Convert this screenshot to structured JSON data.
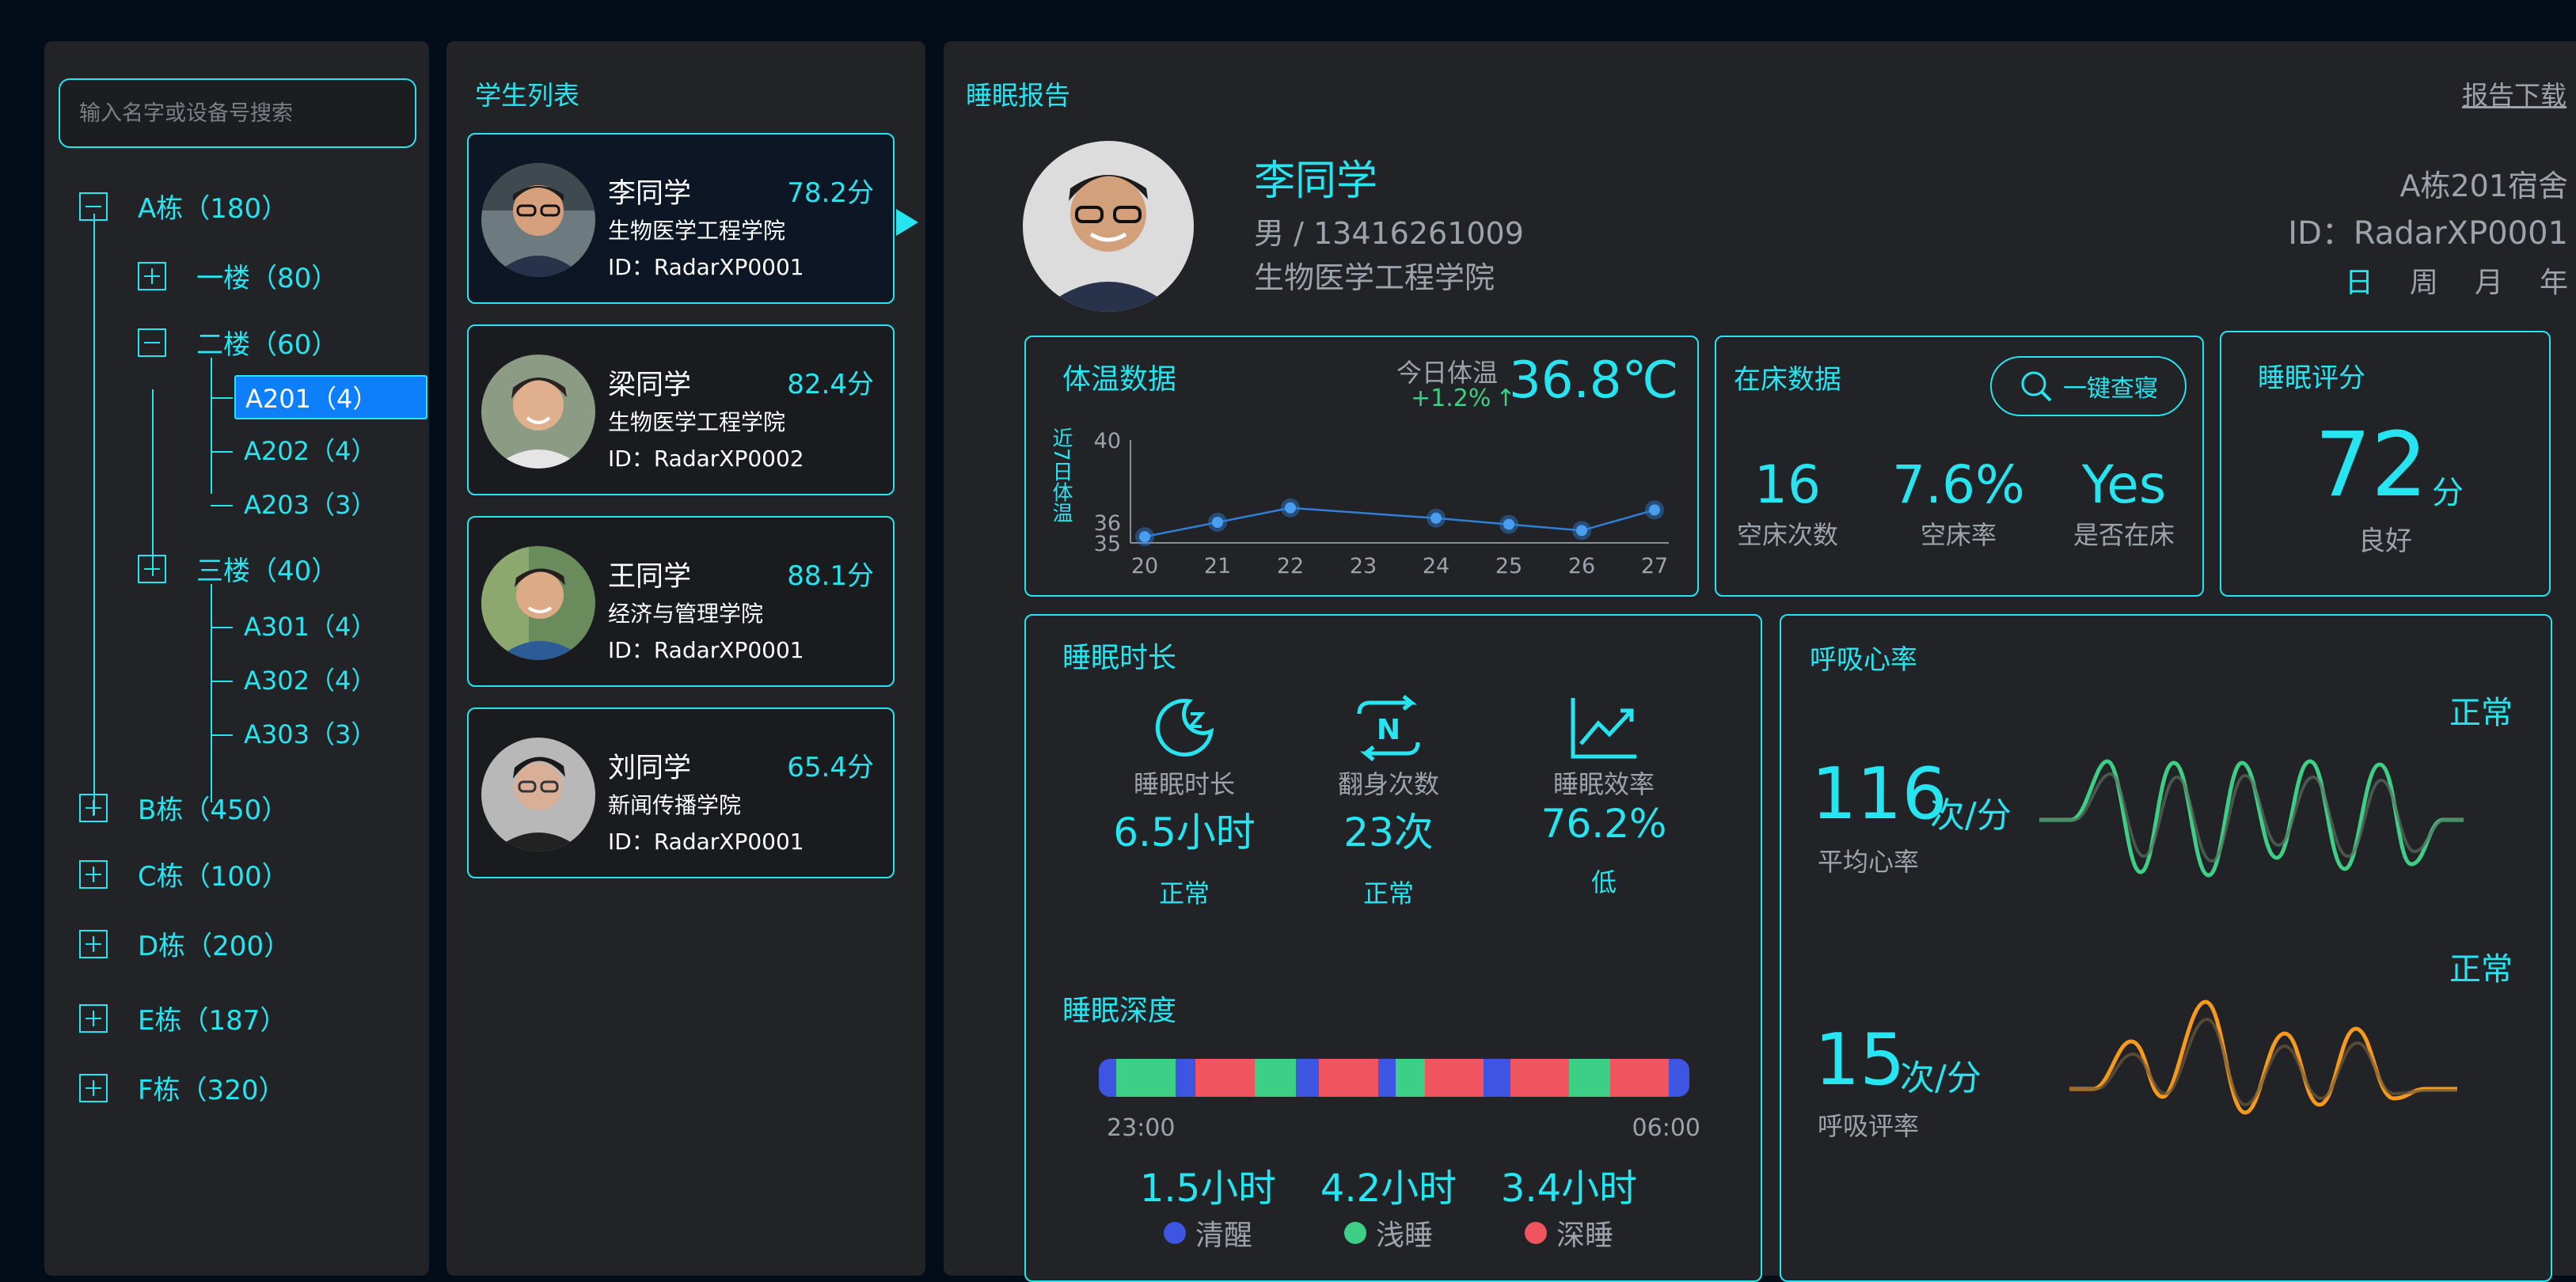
{
  "sidebar": {
    "search_placeholder": "输入名字或设备号搜索",
    "buildings": [
      {
        "label": "A栋（180）",
        "expanded": true
      },
      {
        "label": "B栋（450）",
        "expanded": false
      },
      {
        "label": "C栋（100）",
        "expanded": false
      },
      {
        "label": "D栋（200）",
        "expanded": false
      },
      {
        "label": "E栋（187）",
        "expanded": false
      },
      {
        "label": "F栋（320）",
        "expanded": false
      }
    ],
    "floors": [
      {
        "label": "一楼（80）",
        "expanded": false
      },
      {
        "label": "二楼（60）",
        "expanded": true
      },
      {
        "label": "三楼（40）",
        "expanded": true
      }
    ],
    "rooms_floor2": [
      "A201（4）",
      "A202（4）",
      "A203（3）"
    ],
    "rooms_floor3": [
      "A301（4）",
      "A302（4）",
      "A303（3）"
    ],
    "selected_room": "A201（4）"
  },
  "student_list": {
    "title": "学生列表",
    "students": [
      {
        "name": "李同学",
        "score": "78.2分",
        "college": "生物医学工程学院",
        "id": "ID：RadarXP0001"
      },
      {
        "name": "梁同学",
        "score": "82.4分",
        "college": "生物医学工程学院",
        "id": "ID：RadarXP0002"
      },
      {
        "name": "王同学",
        "score": "88.1分",
        "college": "经济与管理学院",
        "id": "ID：RadarXP0001"
      },
      {
        "name": "刘同学",
        "score": "65.4分",
        "college": "新闻传播学院",
        "id": "ID：RadarXP0001"
      }
    ]
  },
  "report": {
    "title": "睡眠报告",
    "download": "报告下载",
    "profile": {
      "name": "李同学",
      "gender_phone": "男 / 13416261009",
      "college": "生物医学工程学院",
      "dorm": "A栋201宿舍",
      "device_id": "ID：RadarXP0001",
      "periods": [
        "日",
        "周",
        "月",
        "年"
      ]
    },
    "temperature": {
      "title": "体温数据",
      "today_label": "今日体温",
      "delta": "+1.2%",
      "delta_arrow": "↑",
      "value": "36.8℃",
      "y_label": "近7日体温"
    },
    "bed": {
      "title": "在床数据",
      "check_button": "一键查寝",
      "stats": [
        {
          "value": "16",
          "label": "空床次数"
        },
        {
          "value": "7.6%",
          "label": "空床率"
        },
        {
          "value": "Yes",
          "label": "是否在床"
        }
      ]
    },
    "score": {
      "title": "睡眠评分",
      "value": "72",
      "unit": "分",
      "grade": "良好"
    },
    "duration": {
      "title": "睡眠时长",
      "items": [
        {
          "label": "睡眠时长",
          "value": "6.5小时",
          "status": "正常",
          "icon": "moon-icon"
        },
        {
          "label": "翻身次数",
          "value": "23次",
          "status": "正常",
          "icon": "turn-icon"
        },
        {
          "label": "睡眠效率",
          "value": "76.2%",
          "status": "低",
          "icon": "trend-icon"
        }
      ]
    },
    "depth": {
      "title": "睡眠深度",
      "start": "23:00",
      "end": "06:00",
      "segments": [
        {
          "stage": "awake",
          "share": 0.03
        },
        {
          "stage": "light",
          "share": 0.1
        },
        {
          "stage": "awake",
          "share": 0.035
        },
        {
          "stage": "deep",
          "share": 0.1
        },
        {
          "stage": "light",
          "share": 0.07
        },
        {
          "stage": "awake",
          "share": 0.04
        },
        {
          "stage": "deep",
          "share": 0.1
        },
        {
          "stage": "awake",
          "share": 0.03
        },
        {
          "stage": "light",
          "share": 0.05
        },
        {
          "stage": "deep",
          "share": 0.1
        },
        {
          "stage": "awake",
          "share": 0.045
        },
        {
          "stage": "deep",
          "share": 0.1
        },
        {
          "stage": "light",
          "share": 0.07
        },
        {
          "stage": "deep",
          "share": 0.1
        },
        {
          "stage": "awake",
          "share": 0.035
        }
      ],
      "totals": [
        {
          "value": "1.5小时",
          "label": "清醒",
          "color": "#3d55e0"
        },
        {
          "value": "4.2小时",
          "label": "浅睡",
          "color": "#3ecf86"
        },
        {
          "value": "3.4小时",
          "label": "深睡",
          "color": "#f0545e"
        }
      ]
    },
    "vitals": {
      "title": "呼吸心率",
      "heart": {
        "status": "正常",
        "value": "116",
        "unit": "次/分",
        "label": "平均心率"
      },
      "breath": {
        "status": "正常",
        "value": "15",
        "unit": "次/分",
        "label": "呼吸评率"
      }
    },
    "colors": {
      "accent": "#27e5f0",
      "awake": "#3d55e0",
      "light": "#3ecf86",
      "deep": "#f0545e",
      "heart_wave": "#3ecf86",
      "breath_wave": "#f59a1d",
      "selected": "#0d7ff8"
    }
  },
  "chart_data": {
    "type": "line",
    "x": [
      20,
      21,
      22,
      23,
      24,
      25,
      26,
      27
    ],
    "series": [
      {
        "values": [
          35.3,
          36.0,
          36.7,
          null,
          36.2,
          35.9,
          35.6,
          36.6
        ]
      }
    ],
    "y_ticks": [
      35,
      36,
      40
    ],
    "x_ticks": [
      "20",
      "21",
      "22",
      "23",
      "24",
      "25",
      "26",
      "27"
    ],
    "ylim": [
      35,
      40
    ],
    "ylabel": "近7日体温",
    "grid": false
  }
}
